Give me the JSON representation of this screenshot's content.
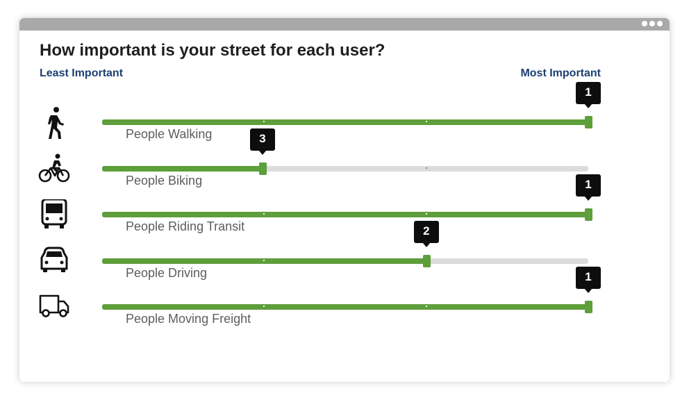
{
  "question": "How important is your street for each user?",
  "scale": {
    "min_label": "Least Important",
    "max_label": "Most Important"
  },
  "colors": {
    "fill": "#5e9e3b",
    "track": "#dcdcdc",
    "badge": "#0d0d0d",
    "scale_label": "#1c3f73"
  },
  "users": [
    {
      "icon": "pedestrian-icon",
      "label": "People Walking",
      "rank": "1",
      "level": 1.0
    },
    {
      "icon": "bicycle-icon",
      "label": "People Biking",
      "rank": "3",
      "level": 0.33
    },
    {
      "icon": "bus-icon",
      "label": "People Riding Transit",
      "rank": "1",
      "level": 1.0
    },
    {
      "icon": "car-icon",
      "label": "People Driving",
      "rank": "2",
      "level": 0.667
    },
    {
      "icon": "truck-icon",
      "label": "People Moving Freight",
      "rank": "1",
      "level": 1.0
    }
  ]
}
